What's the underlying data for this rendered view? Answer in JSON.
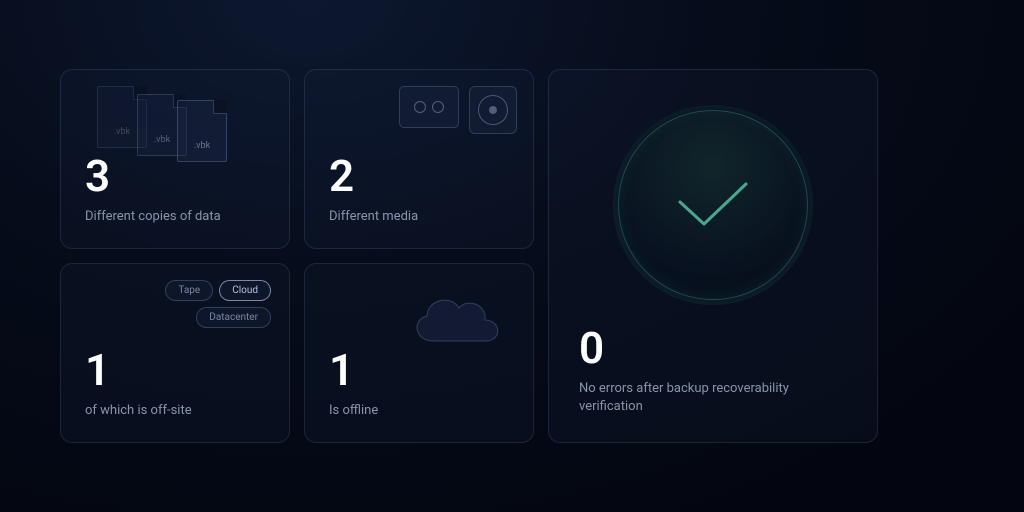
{
  "cards": [
    {
      "value": "3",
      "label": "Different copies of data",
      "file_ext": ".vbk"
    },
    {
      "value": "2",
      "label": "Different media"
    },
    {
      "value": "1",
      "label": "of which is off-site",
      "pills": {
        "tape": "Tape",
        "cloud": "Cloud",
        "datacenter": "Datacenter"
      }
    },
    {
      "value": "1",
      "label": "Is offline"
    }
  ],
  "summary": {
    "value": "0",
    "label": "No errors after backup recoverability verification"
  }
}
